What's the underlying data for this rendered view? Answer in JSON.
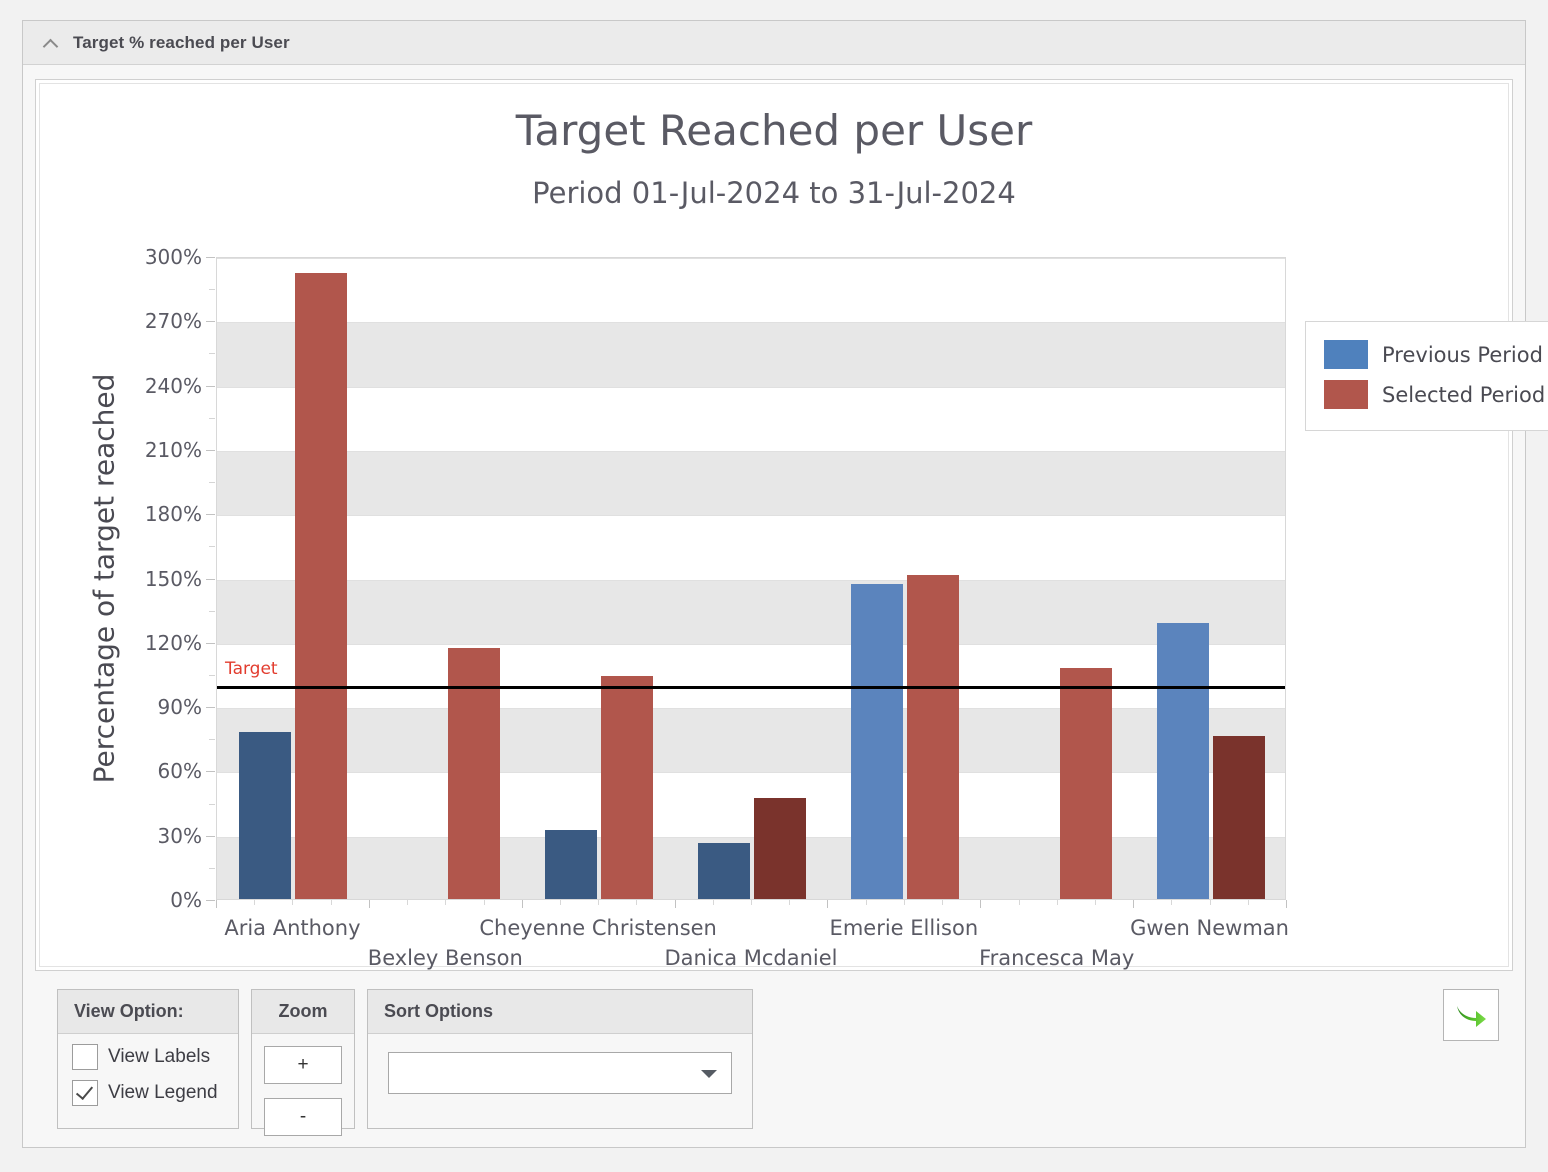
{
  "panel": {
    "title": "Target % reached per User",
    "collapse_icon": "chevron-up-icon"
  },
  "chart_data": {
    "type": "bar",
    "title": "Target Reached per User",
    "subtitle": "Period 01-Jul-2024 to 31-Jul-2024",
    "xlabel": "",
    "ylabel": "Percentage of target reached",
    "ylim": [
      0,
      300
    ],
    "ytick_labels": [
      "0%",
      "30%",
      "60%",
      "90%",
      "120%",
      "150%",
      "180%",
      "210%",
      "240%",
      "270%",
      "300%"
    ],
    "ytick_values": [
      0,
      30,
      60,
      90,
      120,
      150,
      180,
      210,
      240,
      270,
      300
    ],
    "grid": true,
    "legend_position": "top-right",
    "categories": [
      "Aria Anthony",
      "Bexley Benson",
      "Cheyenne Christensen",
      "Danica Mcdaniel",
      "Emerie Ellison",
      "Francesca May",
      "Gwen Newman"
    ],
    "series": [
      {
        "name": "Previous Period",
        "color": "#4f81bd",
        "values": [
          78,
          null,
          32,
          26,
          147,
          null,
          129
        ],
        "bar_colors": [
          "#3a5a82",
          null,
          "#3a5a82",
          "#3a5a82",
          "#5b84bd",
          null,
          "#5b84bd"
        ]
      },
      {
        "name": "Selected Period",
        "color": "#b1564c",
        "values": [
          292,
          117,
          104,
          47,
          151,
          108,
          76
        ],
        "bar_colors": [
          "#b1564c",
          "#b1564c",
          "#b1564c",
          "#7a332c",
          "#b1564c",
          "#b1564c",
          "#7a332c"
        ]
      }
    ],
    "reference_line": {
      "label": "Target",
      "value": 100,
      "color": "#000000",
      "label_color": "#e23c2e"
    }
  },
  "legend": {
    "items": [
      {
        "label": "Previous Period",
        "color": "#4f81bd"
      },
      {
        "label": "Selected Period",
        "color": "#b1564c"
      }
    ]
  },
  "toolbar": {
    "view_options": {
      "title": "View Option:",
      "items": [
        {
          "label": "View Labels",
          "checked": false
        },
        {
          "label": "View Legend",
          "checked": true
        }
      ]
    },
    "zoom": {
      "title": "Zoom",
      "plus_label": "+",
      "minus_label": "-"
    },
    "sort": {
      "title": "Sort Options",
      "selected_value": "",
      "placeholder": ""
    },
    "action": {
      "icon": "green-arrow-right-icon"
    }
  }
}
